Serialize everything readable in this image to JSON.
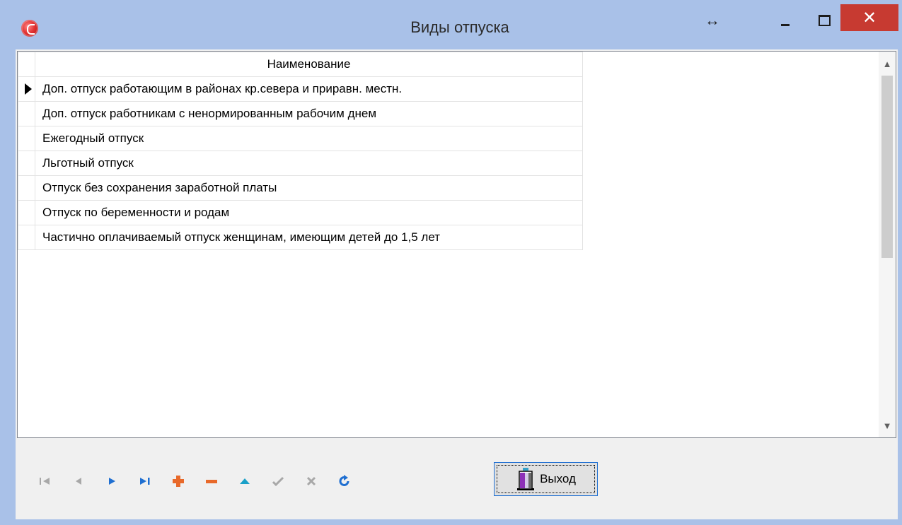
{
  "window": {
    "title": "Виды отпуска",
    "colors": {
      "frame": "#a9c1e8",
      "close": "#c73a31",
      "nav_blue": "#1f6fd1",
      "nav_orange": "#e8692a"
    }
  },
  "grid": {
    "header": "Наименование",
    "selected_row": 0,
    "rows": [
      "Доп. отпуск работающим в районах кр.севера и приравн. местн.",
      "Доп. отпуск работникам с ненормированным рабочим днем",
      "Ежегодный отпуск",
      "Льготный отпуск",
      "Отпуск без сохранения заработной платы",
      "Отпуск по беременности и родам",
      "Частично оплачиваемый отпуск женщинам, имеющим детей до 1,5 лет"
    ]
  },
  "navigator": {
    "buttons": [
      {
        "name": "first-record-icon",
        "enabled": false
      },
      {
        "name": "prior-record-icon",
        "enabled": false
      },
      {
        "name": "next-record-icon",
        "enabled": true
      },
      {
        "name": "last-record-icon",
        "enabled": true
      },
      {
        "name": "insert-record-icon",
        "enabled": true
      },
      {
        "name": "delete-record-icon",
        "enabled": true
      },
      {
        "name": "edit-record-icon",
        "enabled": true
      },
      {
        "name": "post-record-icon",
        "enabled": false
      },
      {
        "name": "cancel-edit-icon",
        "enabled": false
      },
      {
        "name": "refresh-icon",
        "enabled": true
      }
    ]
  },
  "exit_button": {
    "label": "Выход"
  }
}
